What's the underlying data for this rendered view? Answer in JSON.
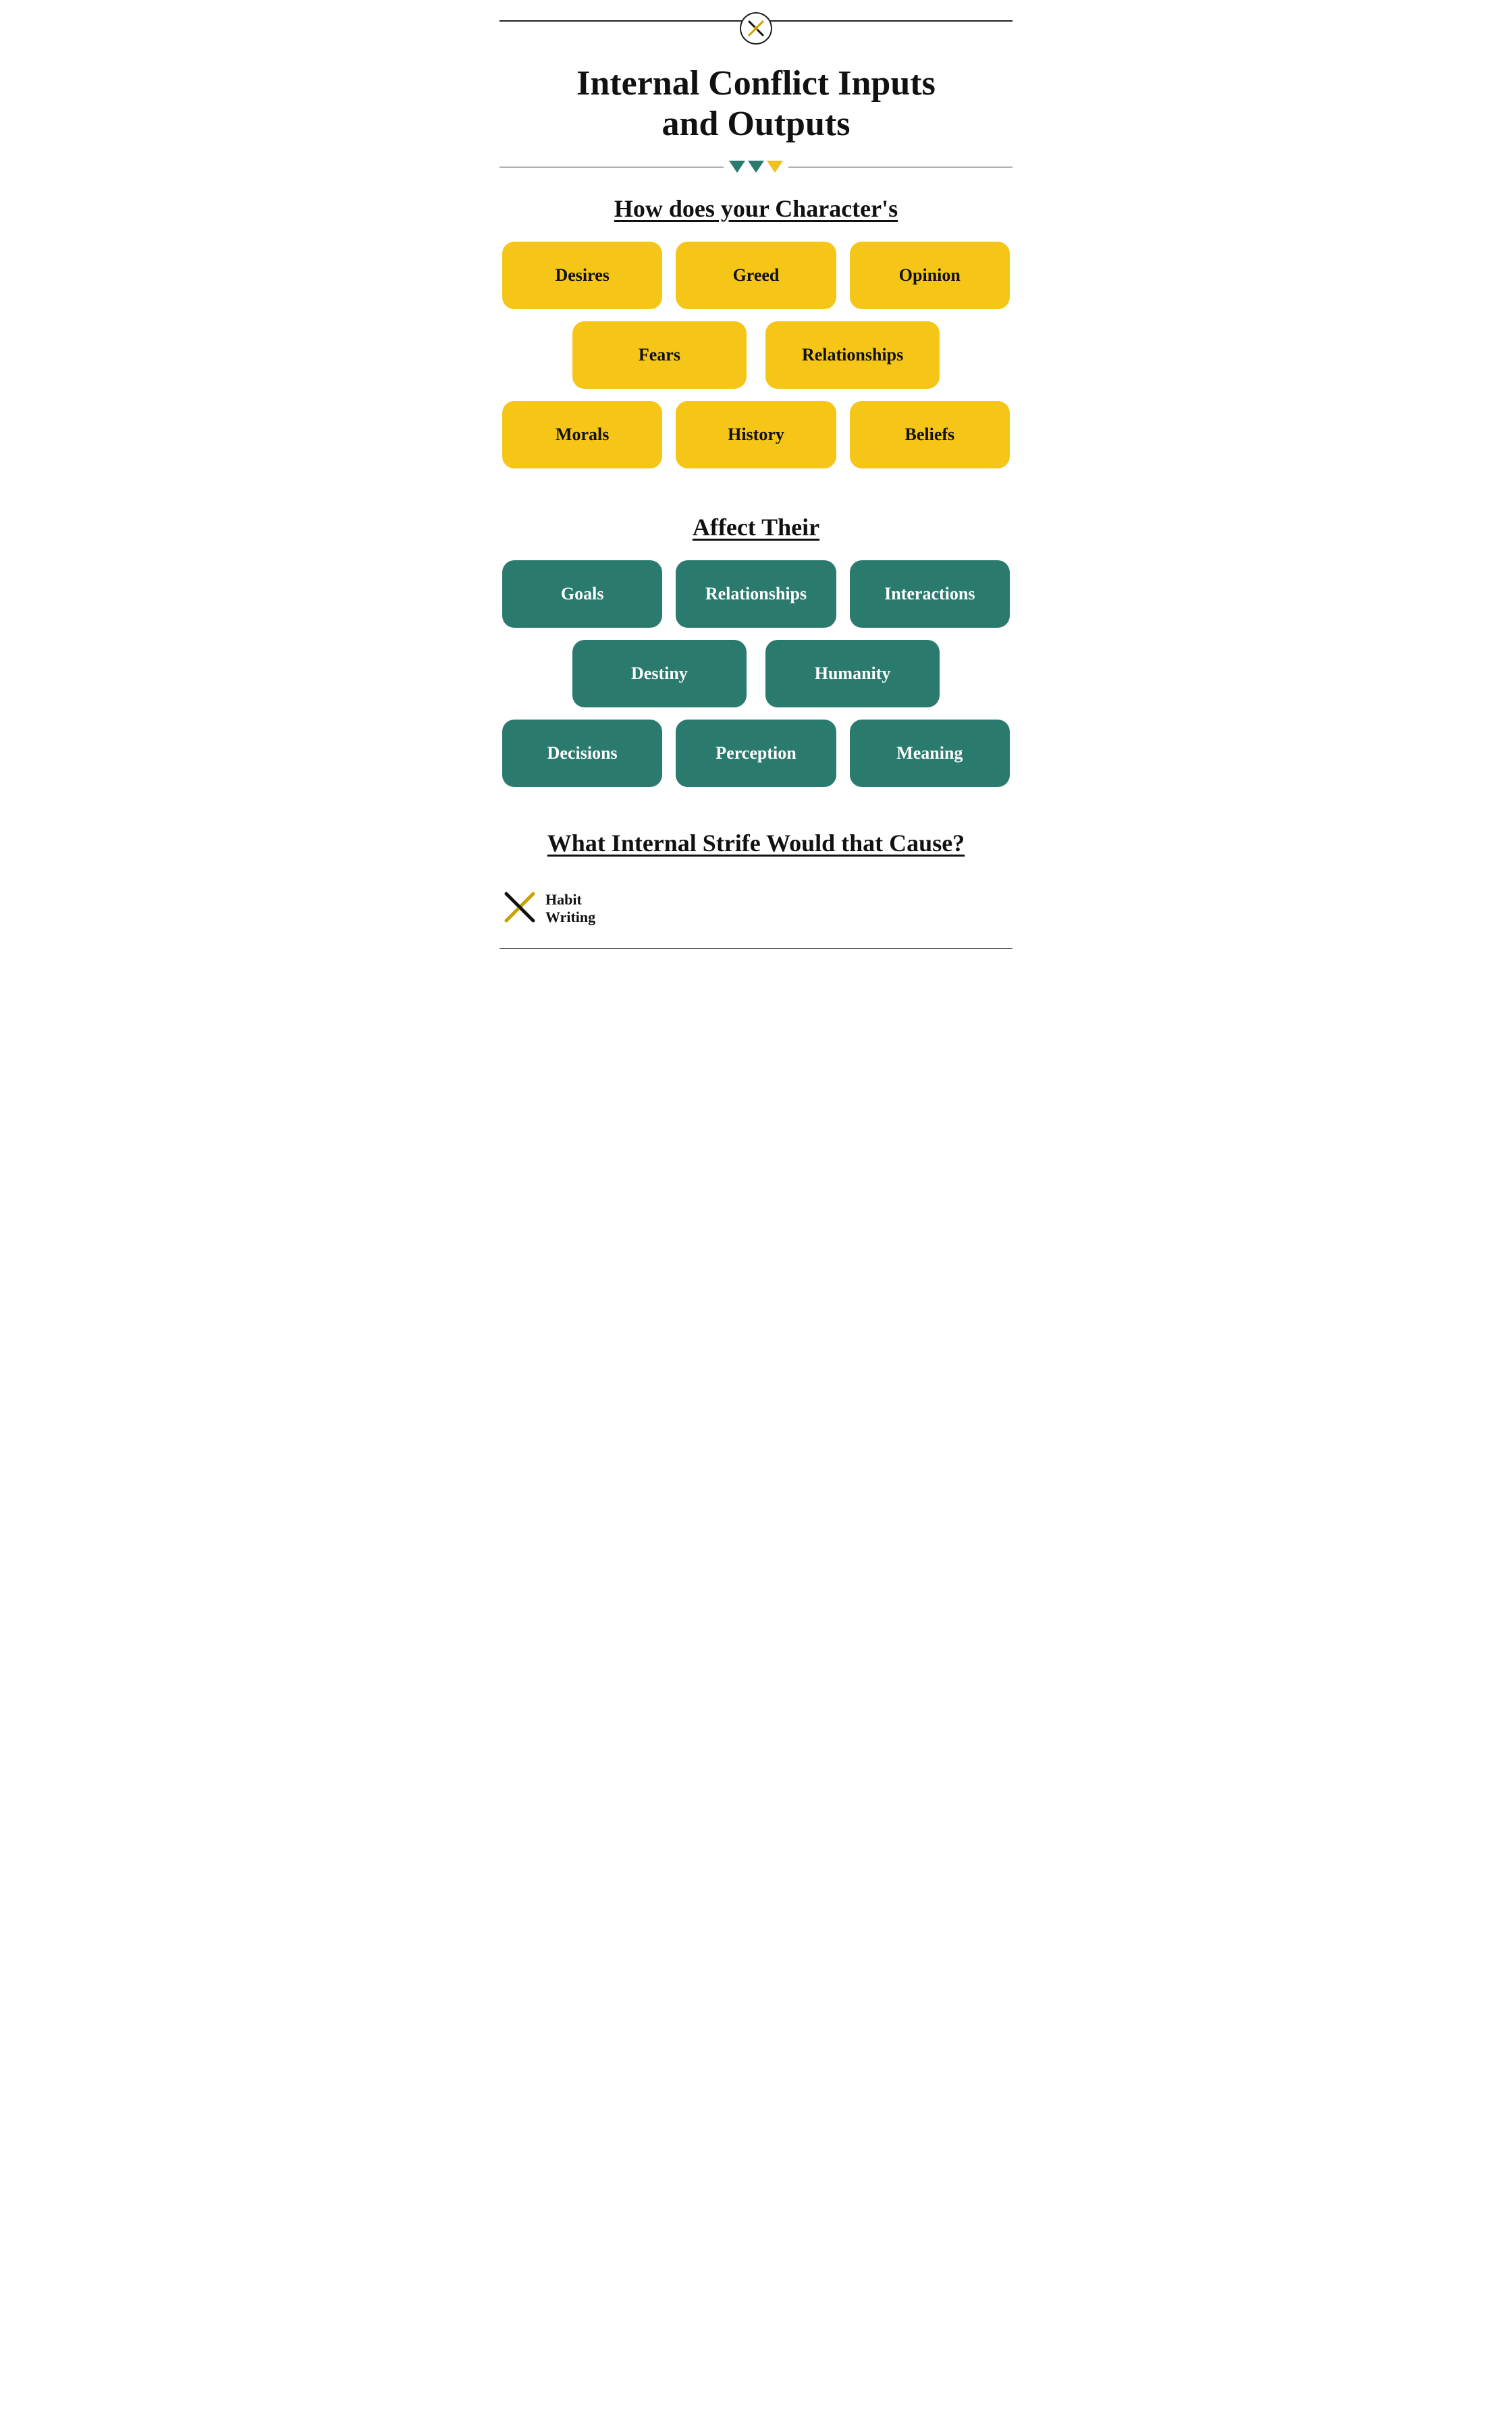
{
  "header": {
    "top_line": true
  },
  "title": {
    "line1": "Internal Conflict Inputs",
    "line2": "and Outputs"
  },
  "section1": {
    "heading": "How does your Character's"
  },
  "inputs_row1": [
    {
      "label": "Desires"
    },
    {
      "label": "Greed"
    },
    {
      "label": "Opinion"
    }
  ],
  "inputs_row2": [
    {
      "label": "Fears"
    },
    {
      "label": "Relationships"
    }
  ],
  "inputs_row3": [
    {
      "label": "Morals"
    },
    {
      "label": "History"
    },
    {
      "label": "Beliefs"
    }
  ],
  "section2": {
    "heading": "Affect Their"
  },
  "outputs_row1": [
    {
      "label": "Goals"
    },
    {
      "label": "Relationships"
    },
    {
      "label": "Interactions"
    }
  ],
  "outputs_row2": [
    {
      "label": "Destiny"
    },
    {
      "label": "Humanity"
    }
  ],
  "outputs_row3": [
    {
      "label": "Decisions"
    },
    {
      "label": "Perception"
    },
    {
      "label": "Meaning"
    }
  ],
  "section3": {
    "heading": "What Internal Strife Would that Cause?"
  },
  "branding": {
    "line1": "Habit",
    "line2": "Writing"
  }
}
